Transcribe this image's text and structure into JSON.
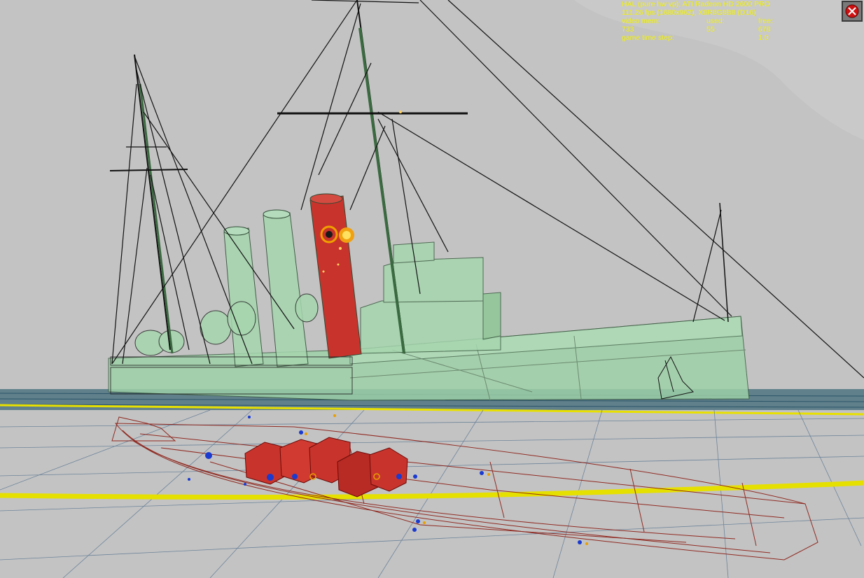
{
  "hud": {
    "line1": "HAL (pure hw vp): ATI Radeon HD 2600 PRO",
    "line2": "111.26 fps (1680x962), X8R8G8B8 (D16)",
    "video_mem": {
      "label": "video mem:",
      "total": "733",
      "used_label": "used:",
      "used": "55",
      "free_label": "free:",
      "free": "678"
    },
    "time_step": {
      "label": "game time step:",
      "value": "1.0"
    }
  },
  "close_button": {
    "icon": "stop-icon",
    "color": "#d01010"
  },
  "scene": {
    "subject": "debug wireframe view of a warship",
    "colors": {
      "sky": "#c4c4c4",
      "hull": "#9ed2a8",
      "hit_funnel": "#c8342c",
      "hud_text": "#f2f20a",
      "waterline": "#e8e000",
      "hull_wire": "#8b1a10"
    }
  }
}
